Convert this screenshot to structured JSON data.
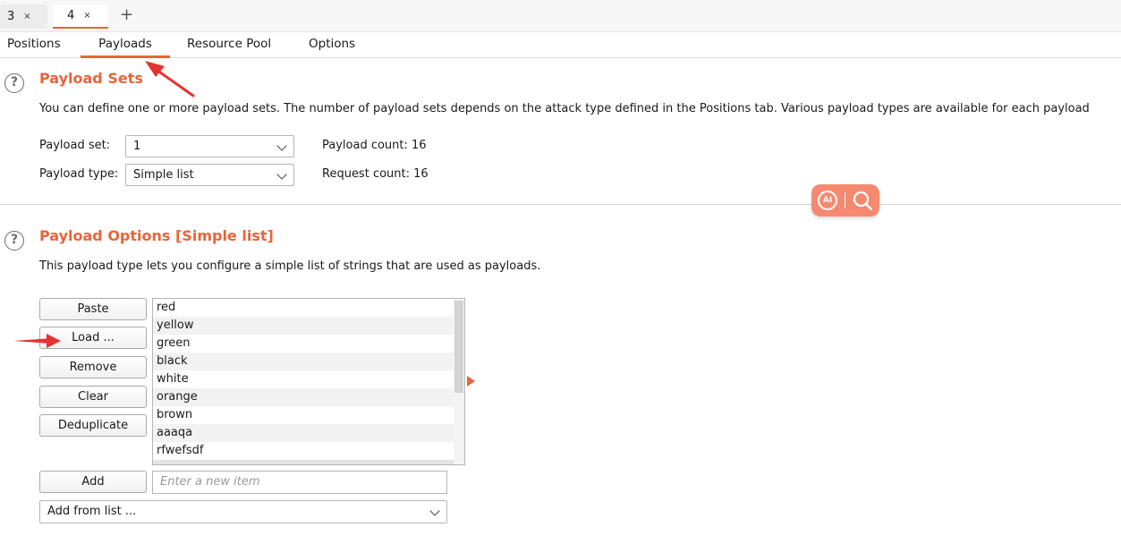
{
  "tabs": [
    {
      "label": "3",
      "close": "×"
    },
    {
      "label": "4",
      "close": "×"
    }
  ],
  "new_tab_label": "+",
  "subtabs": [
    "Positions",
    "Payloads",
    "Resource Pool",
    "Options"
  ],
  "active_subtab": "Payloads",
  "accent_color": "#e8643a",
  "payload_sets": {
    "help": "?",
    "title": "Payload Sets",
    "description": "You can define one or more payload sets. The number of payload sets depends on the attack type defined in the Positions tab. Various payload types are available for each payload",
    "set_label": "Payload set:",
    "set_value": "1",
    "type_label": "Payload type:",
    "type_value": "Simple list",
    "payload_count": "Payload count: 16",
    "request_count": "Request count: 16"
  },
  "payload_options": {
    "help": "?",
    "title": "Payload Options [Simple list]",
    "description": "This payload type lets you configure a simple list of strings that are used as payloads.",
    "buttons": {
      "paste": "Paste",
      "load": "Load ...",
      "remove": "Remove",
      "clear": "Clear",
      "deduplicate": "Deduplicate",
      "add": "Add"
    },
    "items": [
      "red",
      "yellow",
      "green",
      "black",
      "white",
      "orange",
      "brown",
      "aaaqa",
      "rfwefsdf"
    ],
    "new_item_placeholder": "Enter a new item",
    "add_from_list": "Add from list ..."
  },
  "ai_widget": {
    "label": "AI",
    "icons": [
      "ai-icon",
      "search-icon"
    ]
  }
}
